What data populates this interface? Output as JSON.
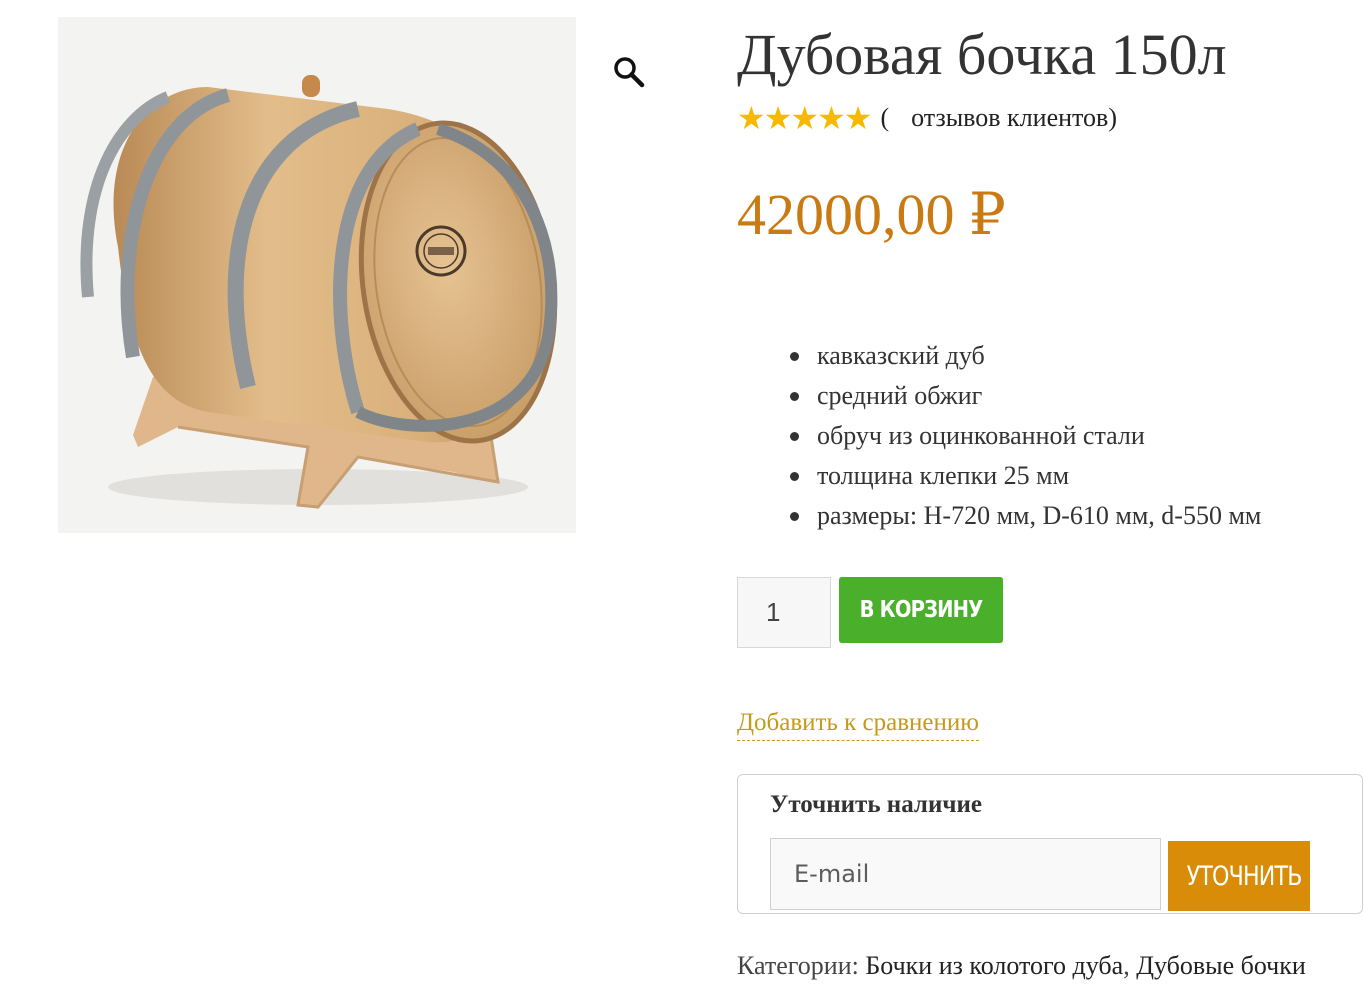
{
  "product": {
    "title": "Дубовая бочка 150л",
    "rating_stars": 5,
    "rating_open": "(",
    "reviews_label": "отзывов клиентов",
    "rating_close": ")",
    "price": "42000,00 ₽",
    "features": [
      "кавказский дуб",
      "средний обжиг",
      "обруч из оцинкованной стали",
      "толщина клепки 25 мм",
      "размеры: H-720 мм, D-610 мм, d-550 мм"
    ],
    "quantity": "1",
    "add_to_cart_label": "В КОРЗИНУ",
    "compare_label": "Добавить к сравнению"
  },
  "availability": {
    "title": "Уточнить наличие",
    "email_placeholder": "E-mail",
    "submit_label": "УТОЧНИТЬ"
  },
  "categories": {
    "label": "Категории:",
    "items": [
      "Бочки из колотого дуба",
      "Дубовые бочки"
    ],
    "separator": ", "
  },
  "colors": {
    "price": "#c97a12",
    "cart_button": "#4ab02b",
    "check_button": "#d88c07",
    "link": "#c59a16",
    "stars": "#f6b900"
  },
  "icons": {
    "zoom": "magnifier-icon",
    "rating": "star-icon"
  }
}
